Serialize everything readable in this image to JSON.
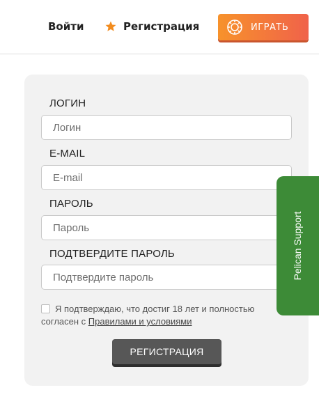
{
  "header": {
    "login_label": "Войти",
    "register_label": "Регистрация",
    "play_label": "ИГРАТЬ",
    "play_gradient": [
      "#f7922b",
      "#f0624a"
    ],
    "star_color": "#f28c1f"
  },
  "form": {
    "fields": [
      {
        "label": "ЛОГИН",
        "placeholder": "Логин"
      },
      {
        "label": "E-MAIL",
        "placeholder": "E-mail"
      },
      {
        "label": "ПАРОЛЬ",
        "placeholder": "Пароль"
      },
      {
        "label": "ПОДТВЕРДИТЕ ПАРОЛЬ",
        "placeholder": "Подтвердите пароль"
      }
    ],
    "agree_text_line1": "Я подтверждаю, что достиг 18 лет и полностью",
    "agree_text_prefix": "согласен с ",
    "terms_link": "Правилами и условиями",
    "agree_checked": false,
    "submit_label": "РЕГИСТРАЦИЯ"
  },
  "support": {
    "label": "Pelican Support",
    "color": "#3d8b37"
  }
}
